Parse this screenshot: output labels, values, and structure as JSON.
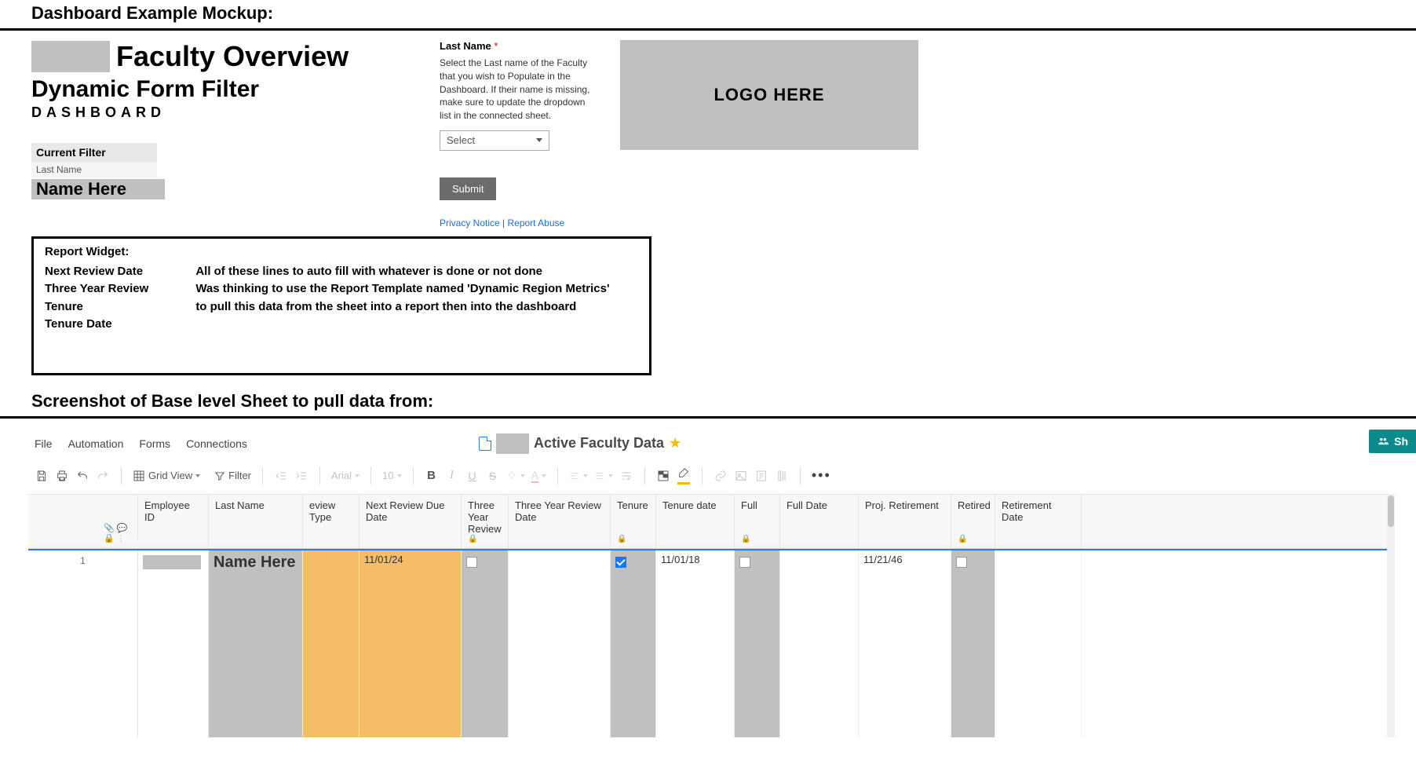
{
  "headings": {
    "mockup": "Dashboard Example Mockup:",
    "sheet": "Screenshot of Base level Sheet to pull data from:"
  },
  "mockup": {
    "title": "Faculty Overview",
    "subtitle": "Dynamic Form Filter",
    "subsub": "DASHBOARD",
    "current_filter_hdr": "Current Filter",
    "current_filter_field": "Last Name",
    "name_here": "Name Here",
    "form": {
      "label": "Last Name",
      "help": "Select the Last name of the Faculty that you wish to Populate in the Dashboard. If their name is missing, make sure to update the dropdown list in the connected sheet.",
      "select_placeholder": "Select",
      "submit": "Submit",
      "privacy": "Privacy Notice",
      "report_abuse": "Report Abuse"
    },
    "logo_here": "LOGO HERE",
    "report_widget": {
      "title": "Report Widget:",
      "labels": [
        "Next Review Date",
        "Three Year Review",
        "Tenure",
        "Tenure Date"
      ],
      "desc1": "All of these lines to auto fill with whatever is done or not done",
      "desc2": "Was thinking to use the Report Template named 'Dynamic Region Metrics'",
      "desc3": "to pull this data from the sheet into a report then into the dashboard"
    }
  },
  "sheet": {
    "menu": [
      "File",
      "Automation",
      "Forms",
      "Connections"
    ],
    "title": "Active Faculty Data",
    "share": "Sh",
    "toolbar": {
      "grid_view": "Grid View",
      "filter": "Filter",
      "font": "Arial",
      "size": "10"
    },
    "columns": [
      "Employee ID",
      "Last Name",
      "eview Type",
      "Next Review Due Date",
      "Three Year Review",
      "Three Year Review Date",
      "Tenure",
      "Tenure date",
      "Full",
      "Full Date",
      "Proj. Retirement",
      "Retired",
      "Retirement Date"
    ],
    "row": {
      "num": "1",
      "last_name": "Name Here",
      "next_review": "11/01/24",
      "three_yr": false,
      "tenure": true,
      "tenure_date": "11/01/18",
      "full": false,
      "proj_retirement": "11/21/46",
      "retired": false
    }
  }
}
